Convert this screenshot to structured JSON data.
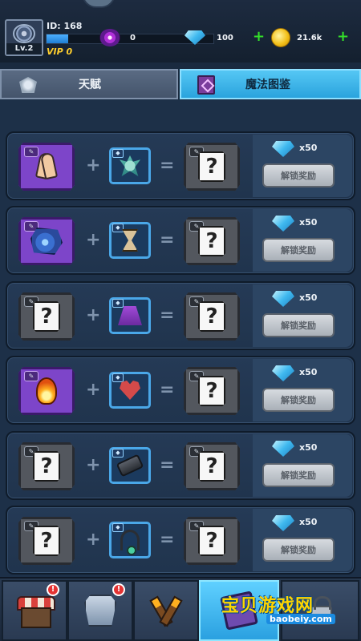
{
  "player": {
    "id_label": "ID: 168",
    "level": "Lv.2",
    "vip": "VIP 0",
    "xp_fraction": 0.13
  },
  "resources": {
    "eyes": "0",
    "gems": "100",
    "coins": "21.6k"
  },
  "tabs": [
    {
      "label": "天赋",
      "active": false
    },
    {
      "label": "魔法图鉴",
      "active": true
    }
  ],
  "recipes": [
    {
      "result_known": true,
      "result_icon": "praying-hands-icon",
      "ingredient_icon": "coral-icon",
      "reward": "x50",
      "button": "解锁奖励"
    },
    {
      "result_known": true,
      "result_icon": "blue-rock-icon",
      "ingredient_icon": "hourglass-icon",
      "reward": "x50",
      "button": "解锁奖励"
    },
    {
      "result_known": false,
      "result_icon": "question-icon",
      "ingredient_icon": "purple-skirt-icon",
      "reward": "x50",
      "button": "解锁奖励"
    },
    {
      "result_known": true,
      "result_icon": "fireball-icon",
      "ingredient_icon": "heart-icon",
      "reward": "x50",
      "button": "解锁奖励"
    },
    {
      "result_known": false,
      "result_icon": "question-icon",
      "ingredient_icon": "gauntlet-icon",
      "reward": "x50",
      "button": "解锁奖励"
    },
    {
      "result_known": false,
      "result_icon": "question-icon",
      "ingredient_icon": "amulet-icon",
      "reward": "x50",
      "button": "解锁奖励"
    }
  ],
  "symbols": {
    "plus": "+",
    "equals": "=",
    "unknown": "?"
  },
  "bottom_nav": [
    {
      "icon": "shop-icon",
      "alert": "!",
      "active": false
    },
    {
      "icon": "armor-icon",
      "alert": "!",
      "active": false
    },
    {
      "icon": "torch-icon",
      "alert": "",
      "active": false
    },
    {
      "icon": "spellbook-icon",
      "alert": "",
      "active": true
    },
    {
      "icon": "lock-icon",
      "alert": "",
      "active": false
    }
  ],
  "watermark": {
    "text": "宝贝游戏网",
    "url": "baobeiy.com"
  },
  "colors": {
    "accent": "#2aa3dd",
    "gem": "#3fb9ef",
    "coin": "#f3c11b",
    "vip": "#ffcf2e",
    "known_slot": "#7d45c9"
  }
}
